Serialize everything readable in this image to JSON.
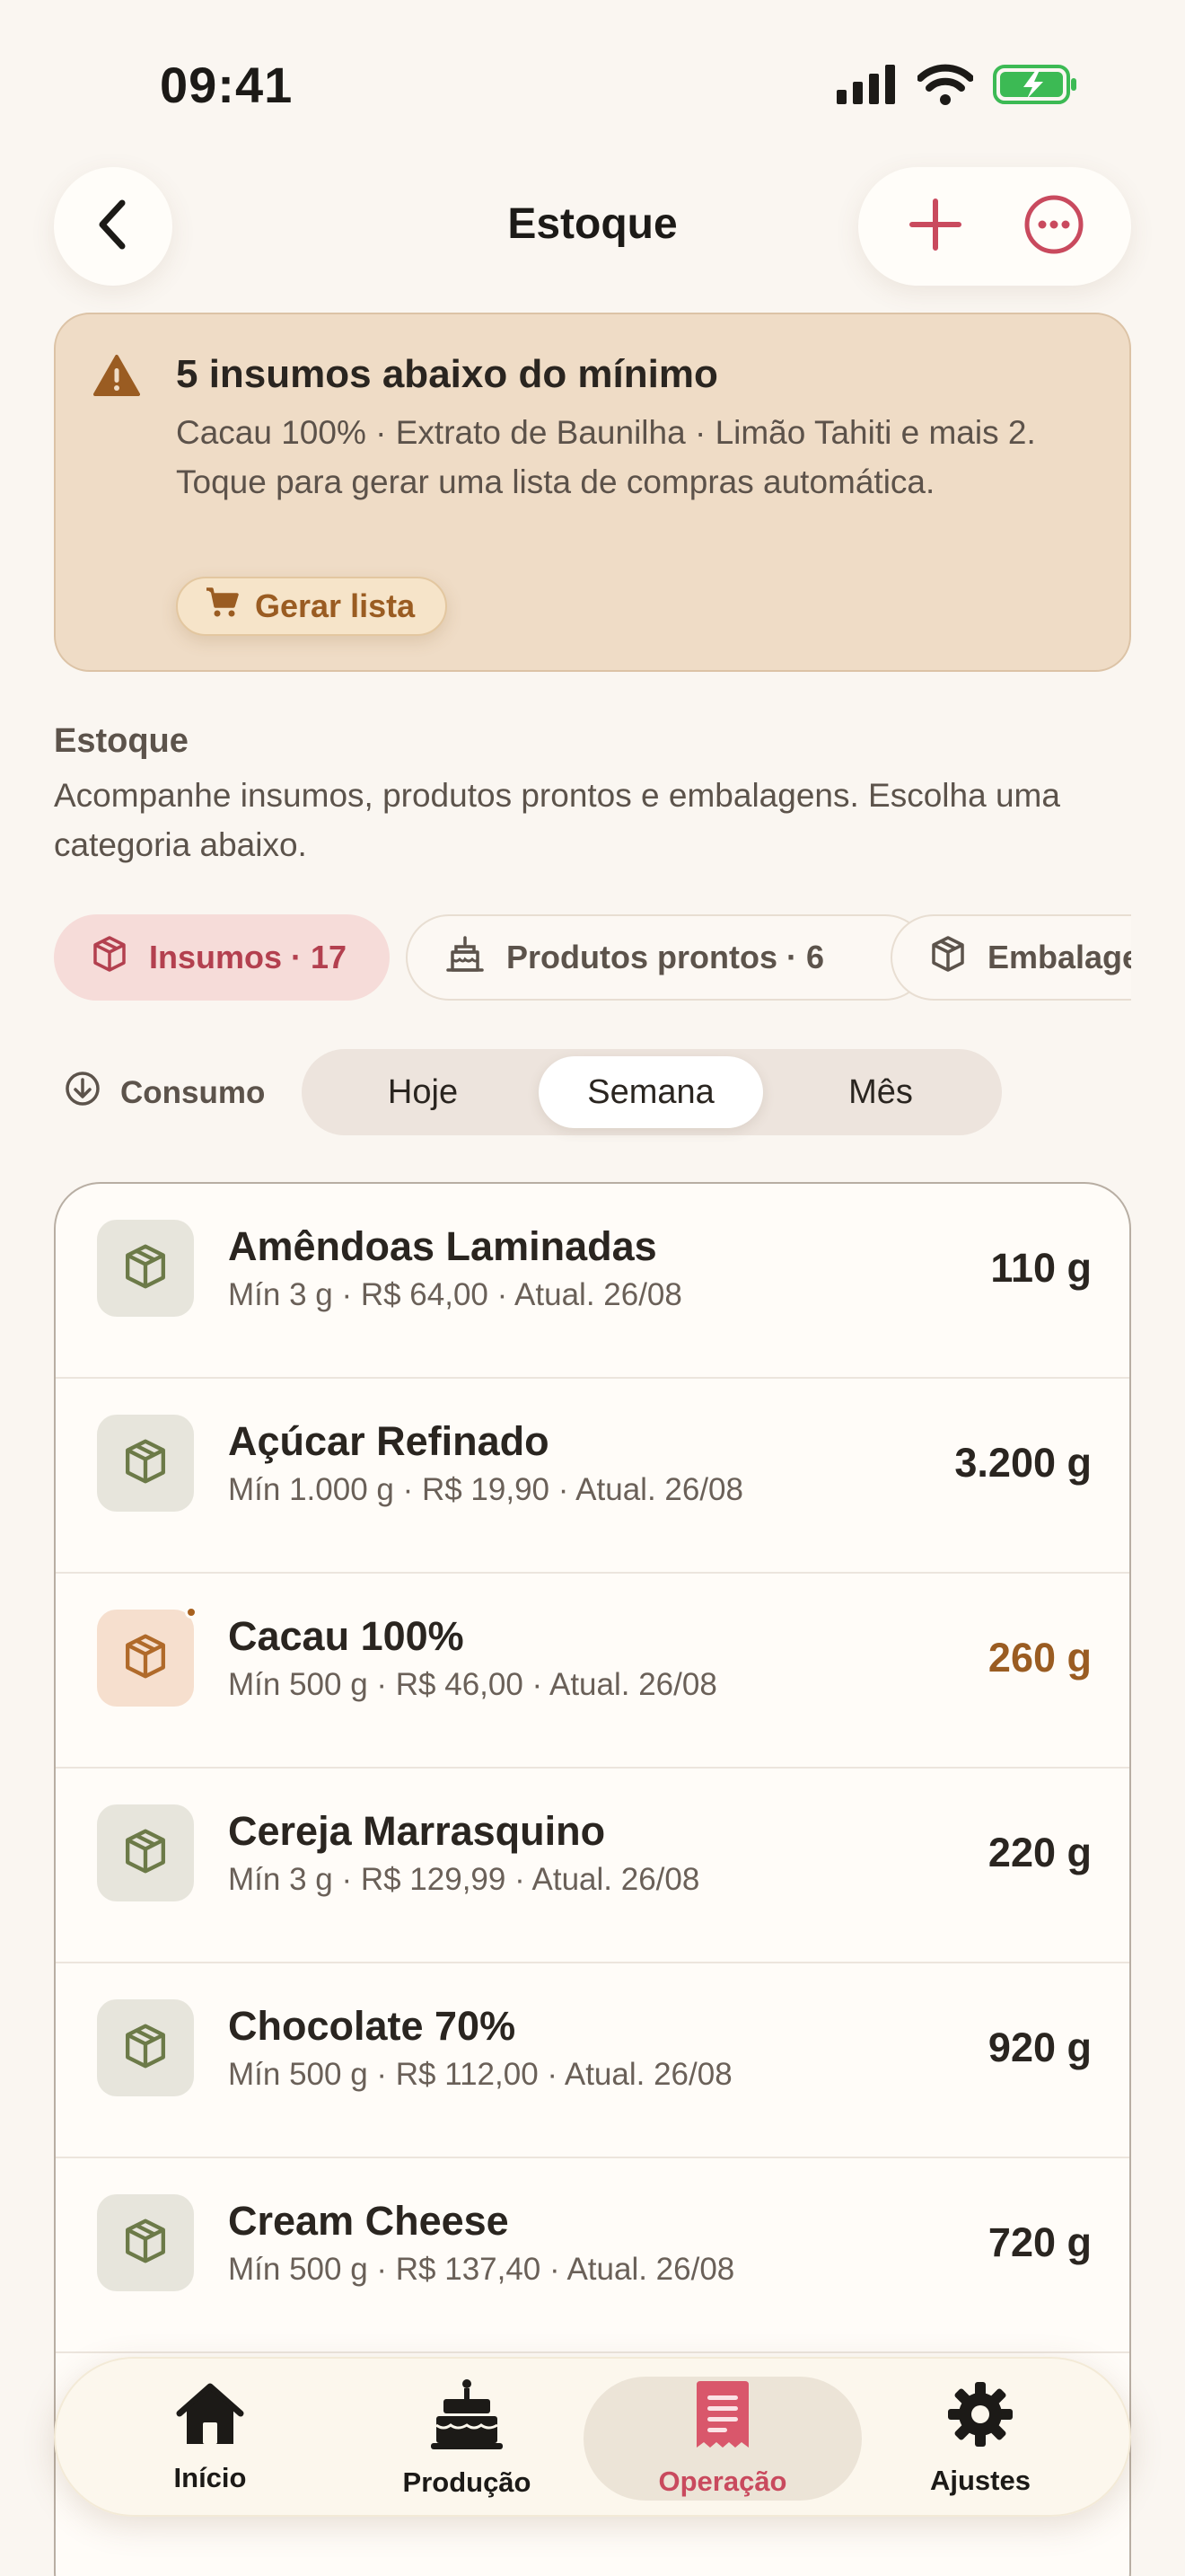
{
  "status_bar": {
    "time": "09:41"
  },
  "nav": {
    "title": "Estoque"
  },
  "alert": {
    "title": "5 insumos abaixo do mínimo",
    "body": "Cacau 100% · Extrato de Baunilha · Limão Tahiti e mais 2. Toque para gerar uma lista de compras automática.",
    "button_label": "Gerar lista"
  },
  "section": {
    "title": "Estoque",
    "description": "Acompanhe insumos, produtos prontos e embalagens. Escolha uma categoria abaixo."
  },
  "chips": [
    {
      "label": "Insumos · 17",
      "active": true
    },
    {
      "label": "Produtos prontos · 6",
      "active": false
    },
    {
      "label": "Embalagens",
      "active": false
    }
  ],
  "consumo": {
    "label": "Consumo",
    "options": [
      "Hoje",
      "Semana",
      "Mês"
    ],
    "selected": "Semana"
  },
  "items": [
    {
      "name": "Amêndoas Laminadas",
      "meta": "Mín 3 g · R$ 64,00 · Atual. 26/08",
      "qty": "110 g",
      "low": false
    },
    {
      "name": "Açúcar Refinado",
      "meta": "Mín 1.000 g · R$ 19,90 · Atual. 26/08",
      "qty": "3.200 g",
      "low": false
    },
    {
      "name": "Cacau 100%",
      "meta": "Mín 500 g · R$ 46,00 · Atual. 26/08",
      "qty": "260 g",
      "low": true
    },
    {
      "name": "Cereja Marrasquino",
      "meta": "Mín 3 g · R$ 129,99 · Atual. 26/08",
      "qty": "220 g",
      "low": false
    },
    {
      "name": "Chocolate 70%",
      "meta": "Mín 500 g · R$ 112,00 · Atual. 26/08",
      "qty": "920 g",
      "low": false
    },
    {
      "name": "Cream Cheese",
      "meta": "Mín 500 g · R$ 137,40 · Atual. 26/08",
      "qty": "720 g",
      "low": false
    }
  ],
  "tabs": [
    {
      "label": "Início",
      "icon": "house-icon"
    },
    {
      "label": "Produção",
      "icon": "cake-icon"
    },
    {
      "label": "Operação",
      "icon": "receipt-icon",
      "active": true
    },
    {
      "label": "Ajustes",
      "icon": "gear-icon"
    }
  ],
  "colors": {
    "background": "#faf6f1",
    "accent": "#c94a5e",
    "warning": "#9a5c22",
    "alert_bg": "#efdcc6",
    "battery": "#3cba54"
  }
}
